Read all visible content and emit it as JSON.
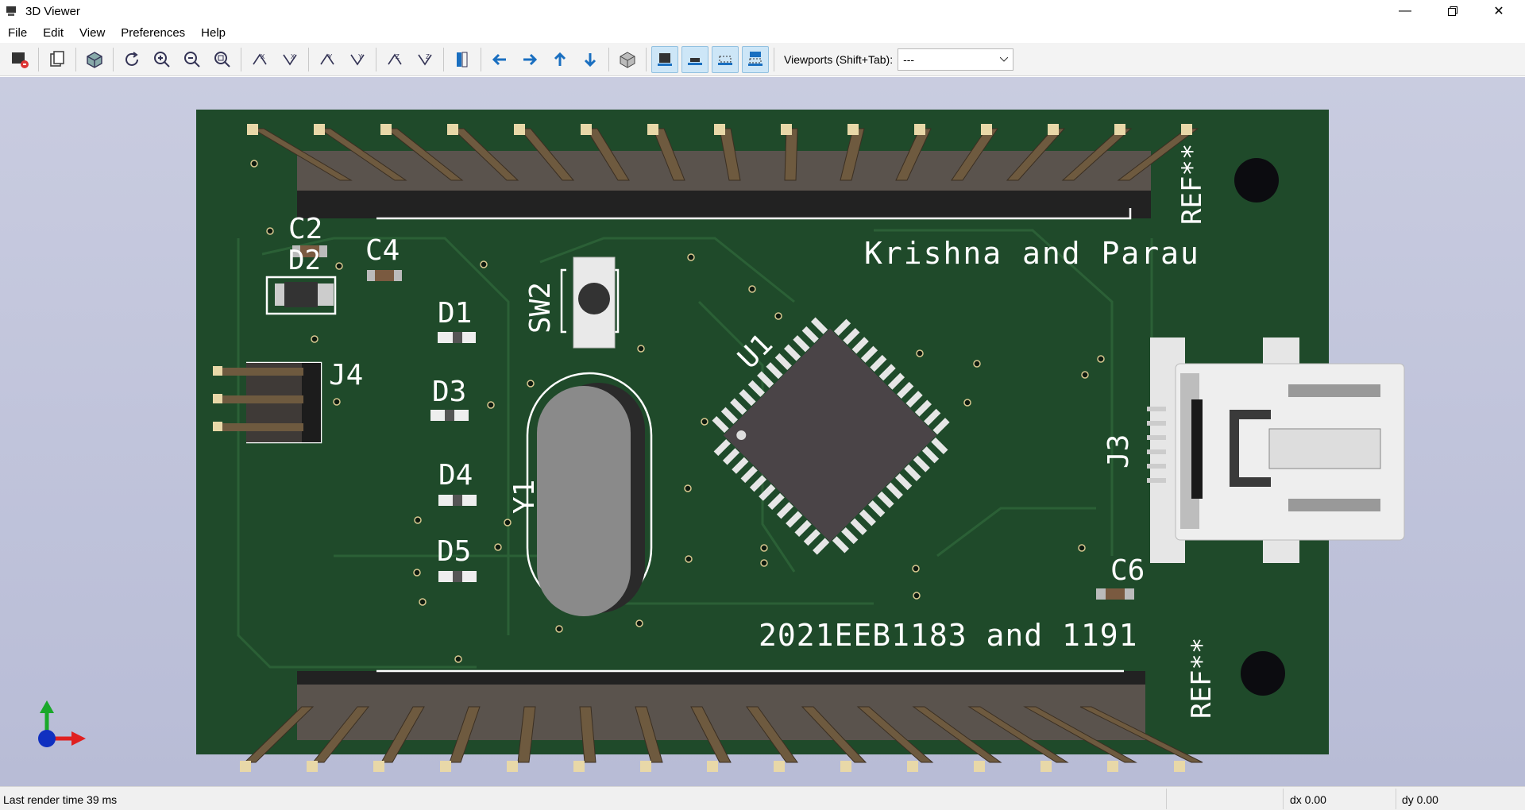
{
  "window": {
    "title": "3D Viewer"
  },
  "menu": {
    "items": [
      "File",
      "Edit",
      "View",
      "Preferences",
      "Help"
    ]
  },
  "toolbar": {
    "viewports_label": "Viewports (Shift+Tab):",
    "viewports_value": "---",
    "icons": [
      "render-save-icon",
      "copy-icon",
      "board-3d-icon",
      "reload-icon",
      "zoom-in-icon",
      "zoom-out-icon",
      "zoom-fit-icon",
      "rotate-x-cw-icon",
      "rotate-x-ccw-icon",
      "rotate-y-cw-icon",
      "rotate-y-ccw-icon",
      "rotate-z-cw-icon",
      "rotate-z-ccw-icon",
      "flip-board-icon",
      "pan-left-icon",
      "pan-right-icon",
      "pan-up-icon",
      "pan-down-icon",
      "ortho-icon",
      "show-tht-icon",
      "show-smd-icon",
      "show-virtual-icon",
      "show-not-in-posfile-icon"
    ]
  },
  "board": {
    "silkscreen": {
      "title1": "Krishna and Parau",
      "title2": "2021EEB1183 and 1191",
      "refs": [
        "C2",
        "D2",
        "C4",
        "D1",
        "SW2",
        "D3",
        "D4",
        "D5",
        "J4",
        "Y1",
        "U1",
        "J3",
        "C6",
        "REF**",
        "REF**"
      ]
    },
    "colors": {
      "pcb": "#1f4a2a",
      "silk": "#ffffff",
      "pad": "#e8d8a8",
      "pin": "#5a4a3a"
    }
  },
  "status": {
    "render_time": "Last render time 39 ms",
    "dx": "dx 0.00",
    "dy": "dy 0.00"
  }
}
